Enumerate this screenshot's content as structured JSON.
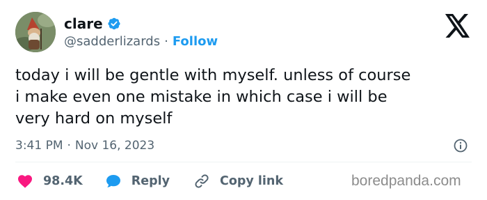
{
  "author": {
    "display_name": "clare",
    "handle": "@sadderlizards",
    "separator": "·",
    "follow_label": "Follow"
  },
  "tweet": {
    "text": "today i will be gentle with myself. unless of course\ni make even one mistake in which case i will be\nvery hard on myself",
    "time": "3:41 PM",
    "separator": "·",
    "date": "Nov 16, 2023"
  },
  "actions": {
    "likes_count": "98.4K",
    "reply_label": "Reply",
    "copy_link_label": "Copy link"
  },
  "watermark": "boredpanda.com",
  "icons": {
    "verified": "verified-badge-icon",
    "platform": "x-logo-icon",
    "info": "info-icon",
    "like": "heart-icon",
    "reply": "speech-bubble-icon",
    "copy": "link-icon"
  },
  "colors": {
    "accent": "#1d9bf0",
    "like": "#f91880",
    "text": "#0f1419",
    "secondary": "#536471"
  }
}
